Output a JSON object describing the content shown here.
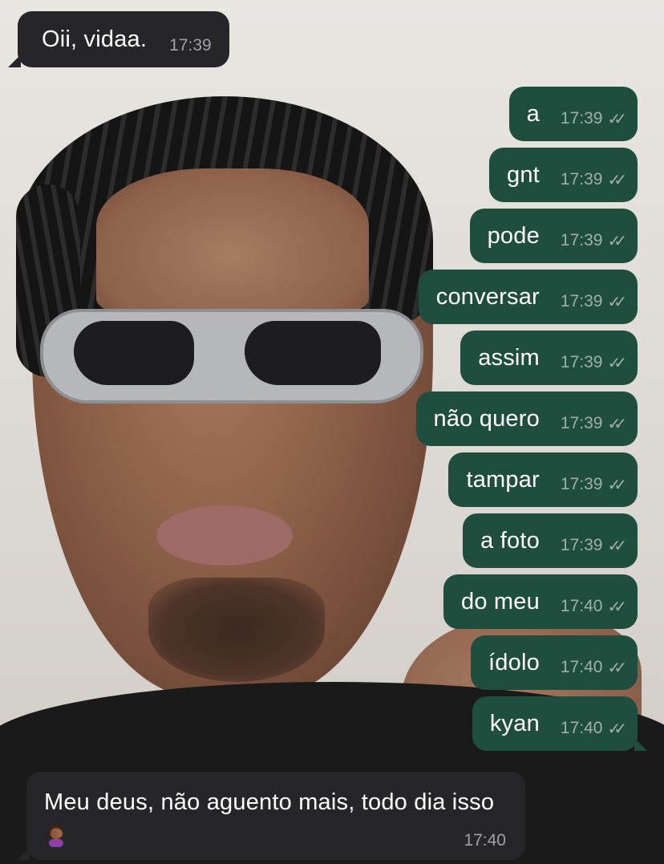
{
  "colors": {
    "incoming_bubble": "#26262a",
    "outgoing_bubble": "#1f4d3e",
    "text": "#ffffff",
    "meta_text": "#bdbdbd"
  },
  "background_photo": {
    "description_icon": "selfie-photo"
  },
  "messages": {
    "incoming_first": {
      "text": "Oii, vidaa.",
      "time": "17:39"
    },
    "outgoing": [
      {
        "text": "a",
        "time": "17:39",
        "status_icon": "double-check-icon"
      },
      {
        "text": "gnt",
        "time": "17:39",
        "status_icon": "double-check-icon"
      },
      {
        "text": "pode",
        "time": "17:39",
        "status_icon": "double-check-icon"
      },
      {
        "text": "conversar",
        "time": "17:39",
        "status_icon": "double-check-icon"
      },
      {
        "text": "assim",
        "time": "17:39",
        "status_icon": "double-check-icon"
      },
      {
        "text": "não quero",
        "time": "17:39",
        "status_icon": "double-check-icon"
      },
      {
        "text": "tampar",
        "time": "17:39",
        "status_icon": "double-check-icon"
      },
      {
        "text": "a foto",
        "time": "17:39",
        "status_icon": "double-check-icon"
      },
      {
        "text": "do meu",
        "time": "17:40",
        "status_icon": "double-check-icon"
      },
      {
        "text": "ídolo",
        "time": "17:40",
        "status_icon": "double-check-icon"
      },
      {
        "text": "kyan",
        "time": "17:40",
        "status_icon": "double-check-icon"
      }
    ],
    "incoming_last": {
      "text": "Meu deus, não aguento mais, todo dia isso",
      "emoji_icon": "woman-facepalming-emoji-icon",
      "time": "17:40"
    }
  },
  "ticks_glyph": "✓✓"
}
